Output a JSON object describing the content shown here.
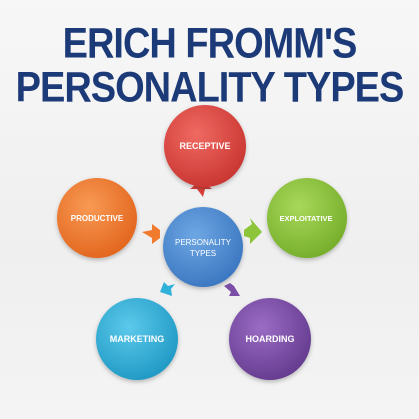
{
  "title": {
    "line1": "ERICH FROMM'S",
    "line2": "PERSONALITY TYPES"
  },
  "center": {
    "line1": "PERSONALITY",
    "line2": "TYPES",
    "color": "#4f8fd6"
  },
  "nodes": {
    "receptive": {
      "label": "RECEPTIVE",
      "color": "#d9413c"
    },
    "exploitative": {
      "label": "EXPLOITATIVE",
      "color": "#8cc43a"
    },
    "hoarding": {
      "label": "HOARDING",
      "color": "#7a4ea6"
    },
    "marketing": {
      "label": "MARKETING",
      "color": "#2fb1da"
    },
    "productive": {
      "label": "PRODUCTIVE",
      "color": "#f07a2d"
    }
  }
}
